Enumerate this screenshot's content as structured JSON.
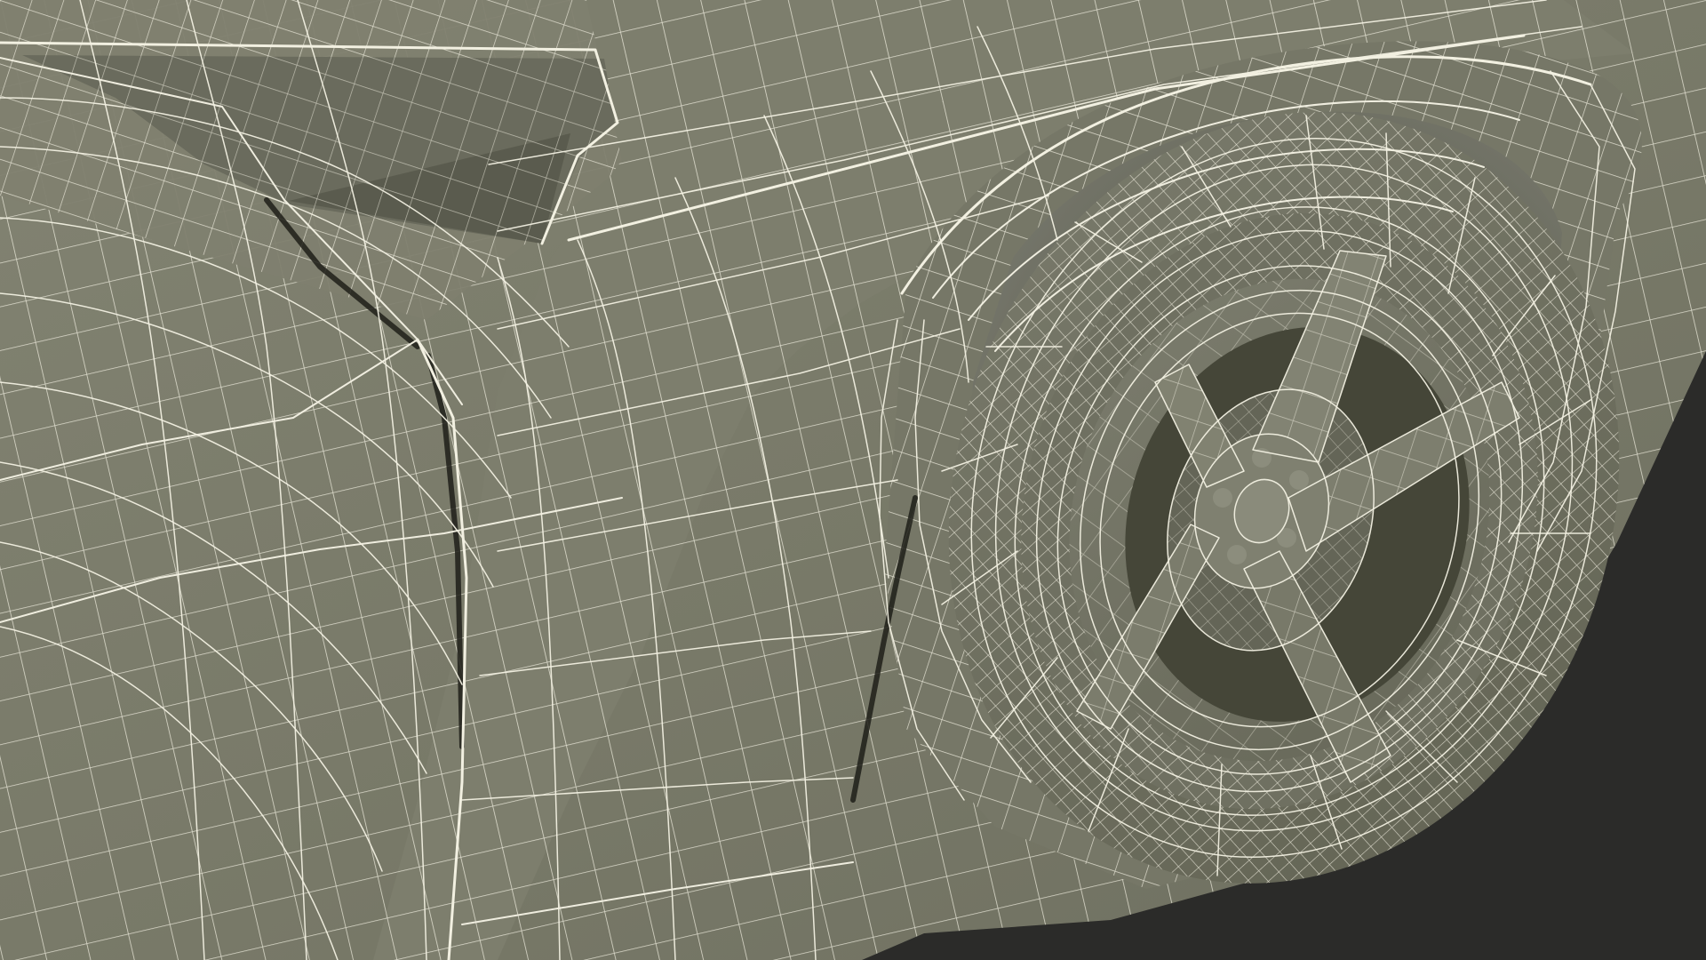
{
  "scene": {
    "background_color": "#2b2b29",
    "body_color": "#7a7b69",
    "shadow_color": "#5b5c4d",
    "wire_color": "#f2f0e1"
  }
}
